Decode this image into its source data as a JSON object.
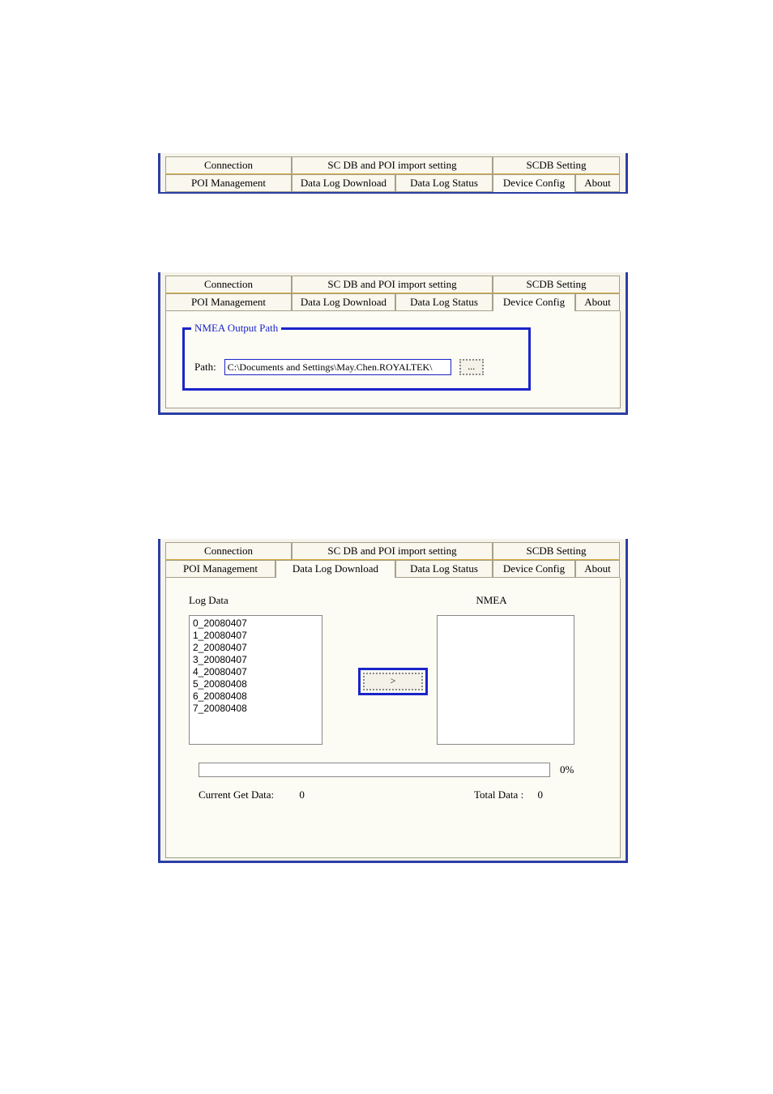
{
  "tabs_top": {
    "connection": "Connection",
    "sc_db_poi": "SC DB and POI import setting",
    "scdb_setting": "SCDB  Setting"
  },
  "tabs_bottom": {
    "poi_mgmt": "POI Management",
    "data_log_download": "Data Log Download",
    "data_log_status": "Data Log Status",
    "device_config": "Device Config",
    "about": "About"
  },
  "panel2": {
    "fieldset_title": "NMEA Output Path",
    "path_label": "Path:",
    "path_value": "C:\\Documents and Settings\\May.Chen.ROYALTEK\\",
    "browse_label": "..."
  },
  "panel3": {
    "log_data_label": "Log Data",
    "nmea_label": "NMEA",
    "items": [
      "0_20080407",
      "1_20080407",
      "2_20080407",
      "3_20080407",
      "4_20080407",
      "5_20080408",
      "6_20080408",
      "7_20080408"
    ],
    "transfer_label": ">",
    "progress_pct": "0%",
    "current_label": "Current Get Data:",
    "current_value": "0",
    "total_label": "Total Data :",
    "total_value": "0"
  }
}
